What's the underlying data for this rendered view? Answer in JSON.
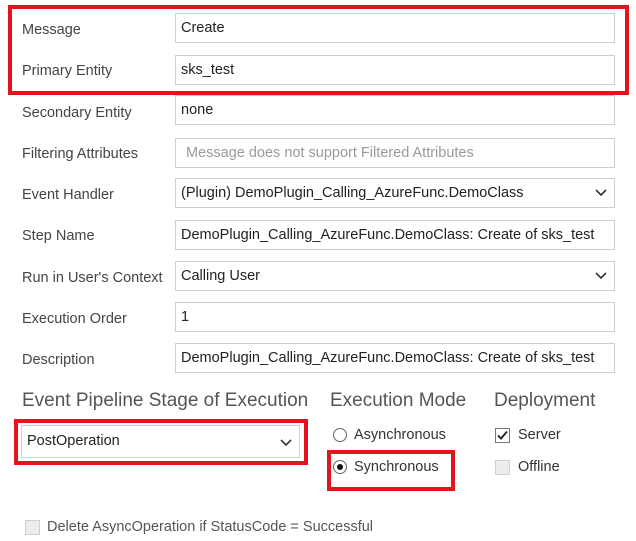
{
  "fields": [
    {
      "label": "Message",
      "value": "Create"
    },
    {
      "label": "Primary Entity",
      "value": "sks_test"
    },
    {
      "label": "Secondary Entity",
      "value": "none"
    },
    {
      "label": "Filtering Attributes",
      "placeholder": "Message does not support Filtered Attributes"
    },
    {
      "label": "Event Handler",
      "value": "(Plugin) DemoPlugin_Calling_AzureFunc.DemoClass"
    },
    {
      "label": "Step Name",
      "value": "DemoPlugin_Calling_AzureFunc.DemoClass: Create of sks_test"
    },
    {
      "label": "Run in User's Context",
      "value": "Calling User"
    },
    {
      "label": "Execution Order",
      "value": "1"
    },
    {
      "label": "Description",
      "value": "DemoPlugin_Calling_AzureFunc.DemoClass: Create of sks_test"
    }
  ],
  "pipeline": {
    "heading": "Event Pipeline Stage of Execution",
    "value": "PostOperation"
  },
  "execution_mode": {
    "heading": "Execution Mode",
    "options": [
      {
        "label": "Asynchronous",
        "selected": false
      },
      {
        "label": "Synchronous",
        "selected": true
      }
    ]
  },
  "deployment": {
    "heading": "Deployment",
    "options": [
      {
        "label": "Server",
        "checked": true
      },
      {
        "label": "Offline",
        "checked": false
      }
    ]
  },
  "delete_async": {
    "label": "Delete AsyncOperation if StatusCode = Successful",
    "checked": false
  },
  "colors": {
    "highlight": "#e3141b",
    "border": "#cfcfcf"
  }
}
